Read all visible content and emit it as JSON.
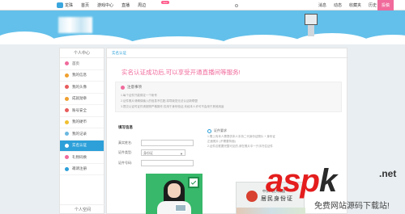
{
  "topbar": {
    "logo_label": "龙珠",
    "nav": [
      "首页",
      "游戏中心",
      "直播",
      "周边"
    ],
    "new_badge": "new",
    "right_items": [
      "消息",
      "动态",
      "收藏夹",
      "历史"
    ],
    "right_badge": "99+",
    "pink_button": "投稿"
  },
  "sidebar": {
    "title": "个人中心",
    "items": [
      {
        "label": "首页",
        "icon": "home-icon",
        "color": "#f06a9b"
      },
      {
        "label": "我的信息",
        "icon": "info-icon",
        "color": "#f0a030"
      },
      {
        "label": "我的头像",
        "icon": "avatar-icon",
        "color": "#e85c5c"
      },
      {
        "label": "成就勋章",
        "icon": "medal-icon",
        "color": "#f0a030"
      },
      {
        "label": "账号安全",
        "icon": "shield-icon",
        "color": "#e85c5c"
      },
      {
        "label": "我的硬币",
        "icon": "coin-icon",
        "color": "#f0c030"
      },
      {
        "label": "我的记录",
        "icon": "record-icon",
        "color": "#6bb8e0"
      },
      {
        "label": "实名认证",
        "icon": "idcard-icon",
        "color": "#ffffff",
        "active": true
      },
      {
        "label": "礼物码换",
        "icon": "gift-icon",
        "color": "#f06a9b"
      },
      {
        "label": "邀请注册",
        "icon": "invite-icon",
        "color": "#2da0d9"
      }
    ],
    "footer": "个人空间"
  },
  "main": {
    "breadcrumb": "实名认证",
    "heading": "实名认证成功后,可以享受开通直播间等服务!",
    "notice": {
      "title": "注意事项",
      "lines": [
        "1.每个证件只能绑定一个帐号",
        "2.证件照片请确保输入的信息不匹配,将导致您无法认证新联盟",
        "3.提交认证时证件请按照严格操作,仅用于身份验证,未经本人许可不会用于其他用途"
      ]
    },
    "form": {
      "title": "填写信息",
      "name_label": "真实姓名:",
      "type_label": "证件类型:",
      "type_value": "身份证",
      "number_label": "证件号码:"
    },
    "requirements": {
      "title": "证件要求",
      "lines": [
        "1.需上传本人需提供本人手持二代身份证照片 + 身份证",
        "正面照片 (不需要背面)",
        "2.证件边框要完整可见的,请在照片中一只手托住证件"
      ]
    },
    "id_card": {
      "country": "中华人民共和国",
      "title": "居民身份证"
    }
  },
  "watermark": {
    "brand_main": "asp",
    "brand_k": "k",
    "brand_tld": ".net",
    "subtitle": "免费网站源码下载站!"
  }
}
